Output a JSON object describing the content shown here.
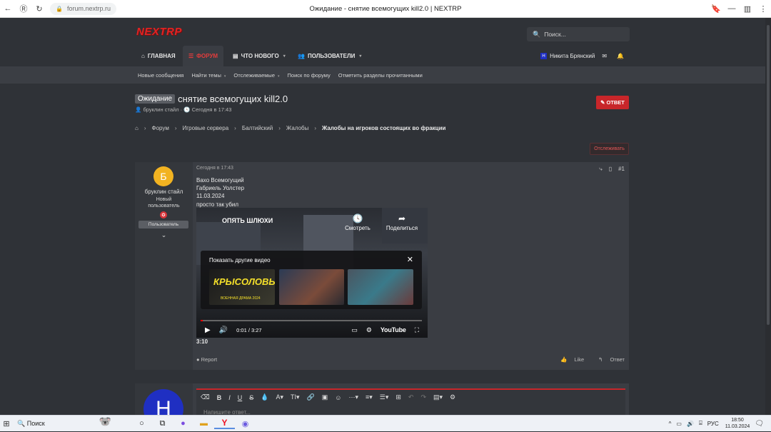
{
  "browser": {
    "back": "←",
    "ext": "Ⓡ",
    "reload": "↻",
    "url": "forum.nextrp.ru",
    "title": "Ожидание - снятие всемогущих kill2.0 | NEXTRP",
    "bookmark": "🔖",
    "minimize": "—",
    "panel": "▥",
    "menu": "⋮"
  },
  "header": {
    "logo": "NEXTRP",
    "search_placeholder": "Поиск..."
  },
  "nav": {
    "items": [
      {
        "label": "ГЛАВНАЯ",
        "icon": "home-icon",
        "glyph": "⌂",
        "active": false,
        "caret": false
      },
      {
        "label": "ФОРУМ",
        "icon": "forum-icon",
        "glyph": "☰",
        "active": true,
        "caret": false
      },
      {
        "label": "ЧТО НОВОГО",
        "icon": "news-icon",
        "glyph": "▤",
        "active": false,
        "caret": true
      },
      {
        "label": "ПОЛЬЗОВАТЕЛИ",
        "icon": "users-icon",
        "glyph": "👥",
        "active": false,
        "caret": true
      }
    ],
    "user": {
      "initial": "Н",
      "name": "Никита Брянский"
    },
    "caret": "▾"
  },
  "subnav": {
    "items": [
      {
        "label": "Новые сообщения",
        "caret": false
      },
      {
        "label": "Найти темы",
        "caret": true
      },
      {
        "label": "Отслеживаемые",
        "caret": true
      },
      {
        "label": "Поиск по форуму",
        "caret": false
      },
      {
        "label": "Отметить разделы прочитанными",
        "caret": false
      }
    ]
  },
  "thread": {
    "prefix": "Ожидание",
    "title": "снятие всемогущих kill2.0",
    "author": "бруклин стайл",
    "date": "Сегодня в 17:43",
    "reply_label": "ОТВЕТ",
    "watch_label": "Отслеживать"
  },
  "breadcrumbs": [
    "Форум",
    "Игровые сервера",
    "Балтийский",
    "Жалобы",
    "Жалобы на игроков состоящих во фракции"
  ],
  "post": {
    "avatar_letter": "Б",
    "username": "бруклин стайл",
    "user_title_1": "Новый",
    "user_title_2": "пользователь",
    "role": "Пользователь",
    "date": "Сегодня в 17:43",
    "number": "#1",
    "lines": [
      "Вахо Всемогущий",
      "Габриель Уолстер",
      "11.03.2024",
      "просто так убил"
    ],
    "after_video": "3:10",
    "report": "Report",
    "like": "Like",
    "reply": "Ответ",
    "video": {
      "title": "ОПЯТЬ ШЛЮХИ",
      "watch_later": "Смотреть",
      "share": "Поделиться",
      "panel_title": "Показать другие видео",
      "thumb1_title": "КРЫСОЛОВЫ",
      "thumb1_sub": "ВОЕННАЯ ДРАМА 2024",
      "time": "0:01 / 3:27",
      "progress": 0.005,
      "brand": "YouTube"
    }
  },
  "reply_editor": {
    "avatar_letter": "Н",
    "placeholder": "Напишите ответ..."
  },
  "taskbar": {
    "search": "Поиск",
    "lang": "РУС",
    "time": "18:50",
    "date": "11.03.2024"
  }
}
